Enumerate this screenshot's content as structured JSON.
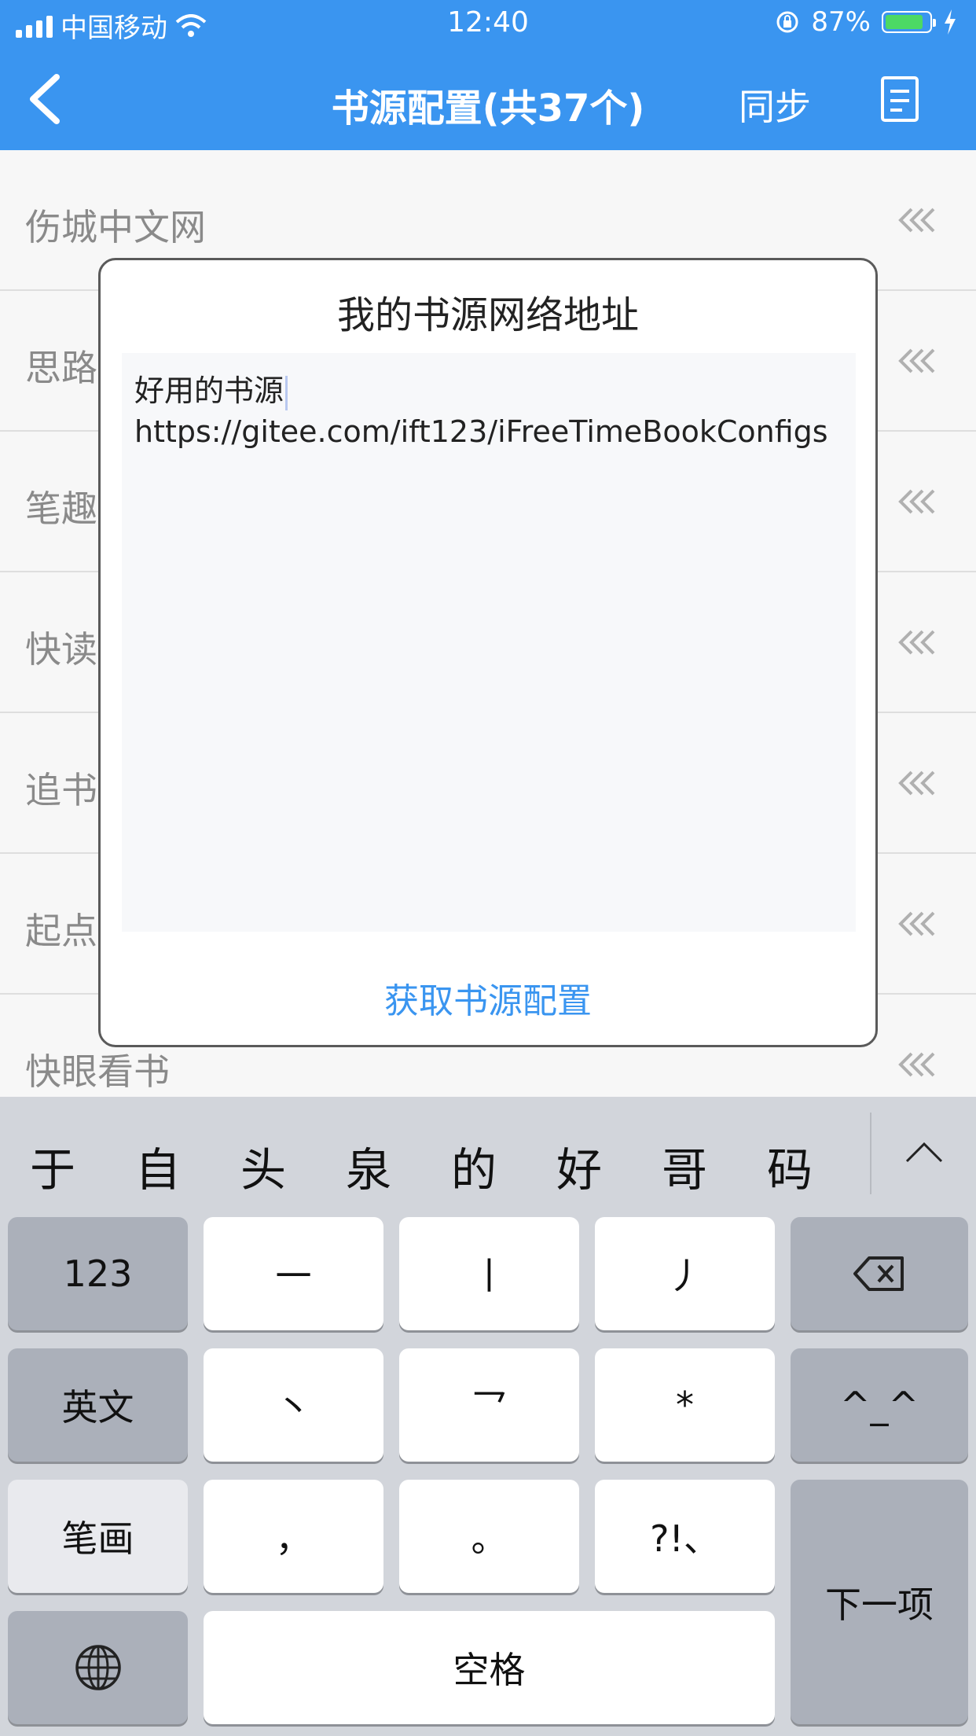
{
  "status": {
    "carrier": "中国移动",
    "time": "12:40",
    "battery_percent": "87%",
    "battery_level": 0.87
  },
  "nav": {
    "title": "书源配置(共37个)",
    "sync_label": "同步"
  },
  "list": {
    "items": [
      "伤城中文网",
      "思路",
      "笔趣",
      "快读",
      "追书",
      "起点",
      "快眼看书"
    ]
  },
  "dialog": {
    "title": "我的书源网络地址",
    "text_line1": "好用的书源",
    "text_line2": "https://gitee.com/ift123/iFreeTimeBookConfigs",
    "action_label": "获取书源配置"
  },
  "keyboard": {
    "candidates": [
      "于",
      "自",
      "头",
      "泉",
      "的",
      "好",
      "哥",
      "码"
    ],
    "keys": {
      "num": "123",
      "k1": "一",
      "k2": "丨",
      "k3": "丿",
      "eng": "英文",
      "k4": "丶",
      "k5": "乛",
      "k6": "*",
      "emoji": "^_^",
      "stroke": "笔画",
      "k7": "，",
      "k8": "。",
      "k9": "?!、",
      "next": "下一项",
      "space": "空格"
    }
  },
  "colors": {
    "accent": "#3a95f0",
    "battery": "#4cd964"
  }
}
